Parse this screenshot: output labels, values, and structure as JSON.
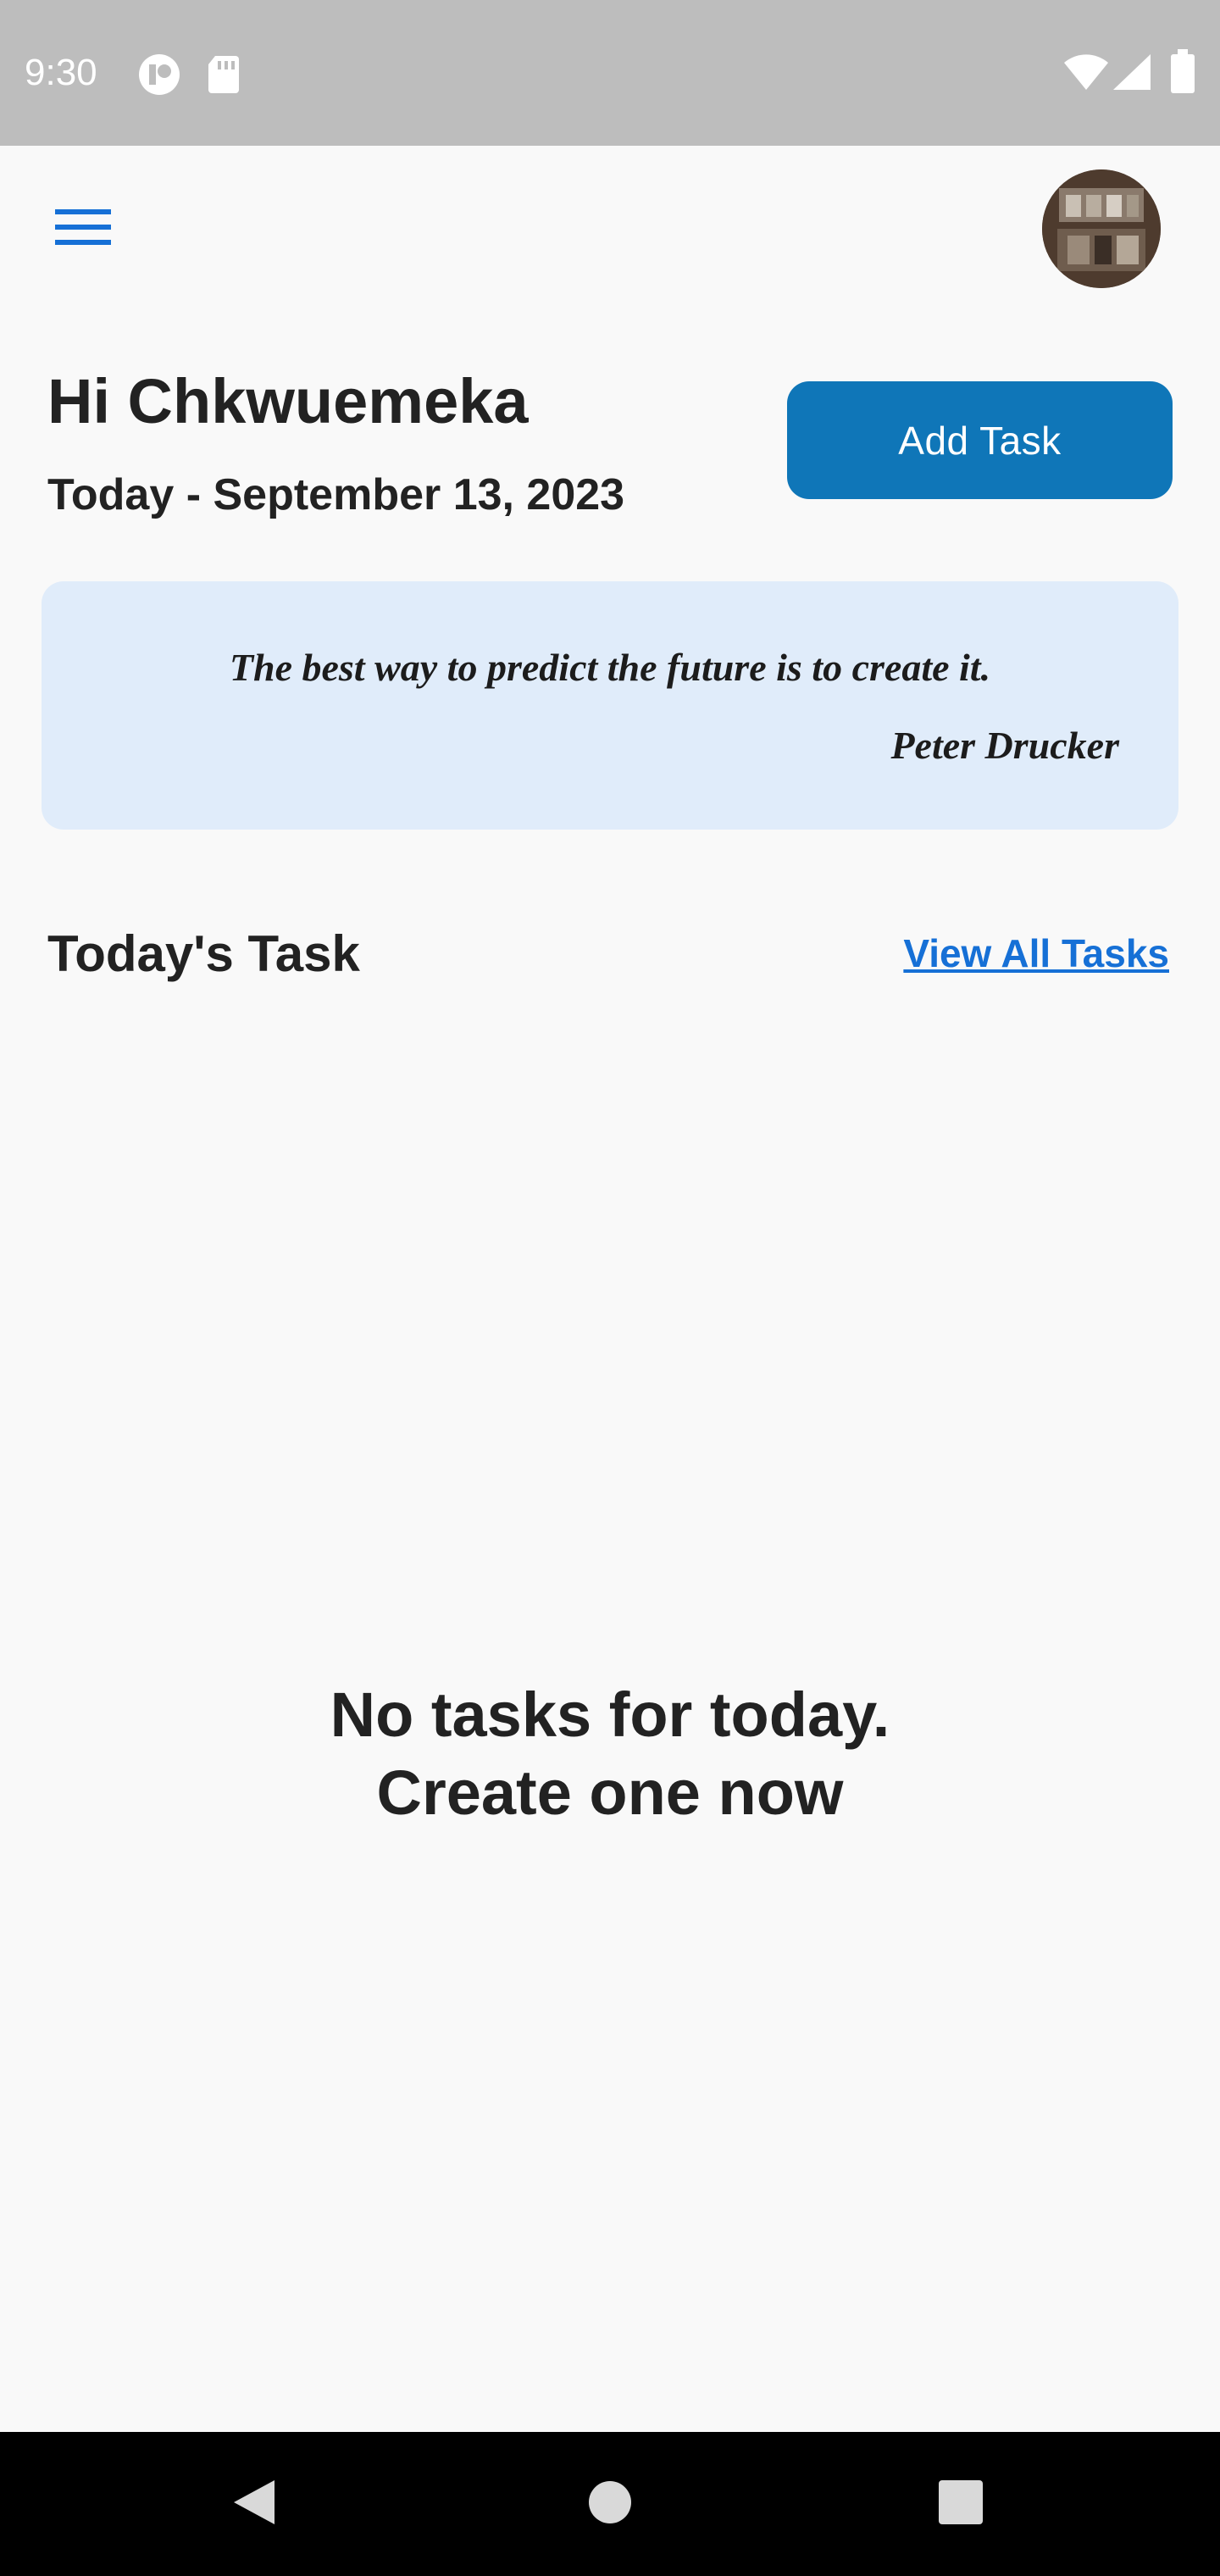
{
  "status_bar": {
    "time": "9:30",
    "icons": [
      "notification-circle-icon",
      "sd-card-icon",
      "wifi-icon",
      "cell-signal-icon",
      "battery-icon"
    ]
  },
  "app_bar": {
    "menu_icon": "hamburger-menu-icon",
    "avatar": "profile-avatar"
  },
  "header": {
    "greeting": "Hi Chkwuemeka",
    "date": "Today - September 13, 2023",
    "add_task_label": "Add Task"
  },
  "quote": {
    "text": "The best way to predict the future is to create it.",
    "author": "Peter Drucker"
  },
  "tasks_section": {
    "title": "Today's Task",
    "view_all_label": "View All Tasks",
    "empty_line1": "No tasks for today.",
    "empty_line2": "Create one now"
  },
  "nav_bar": {
    "back_icon": "back-triangle-icon",
    "home_icon": "home-circle-icon",
    "recents_icon": "recents-square-icon"
  },
  "colors": {
    "primary_button": "#0f76b8",
    "link": "#1670d6",
    "quote_background": "#e0ecfa",
    "page_background": "#f9f9f9",
    "status_bar": "#bdbdbd"
  }
}
